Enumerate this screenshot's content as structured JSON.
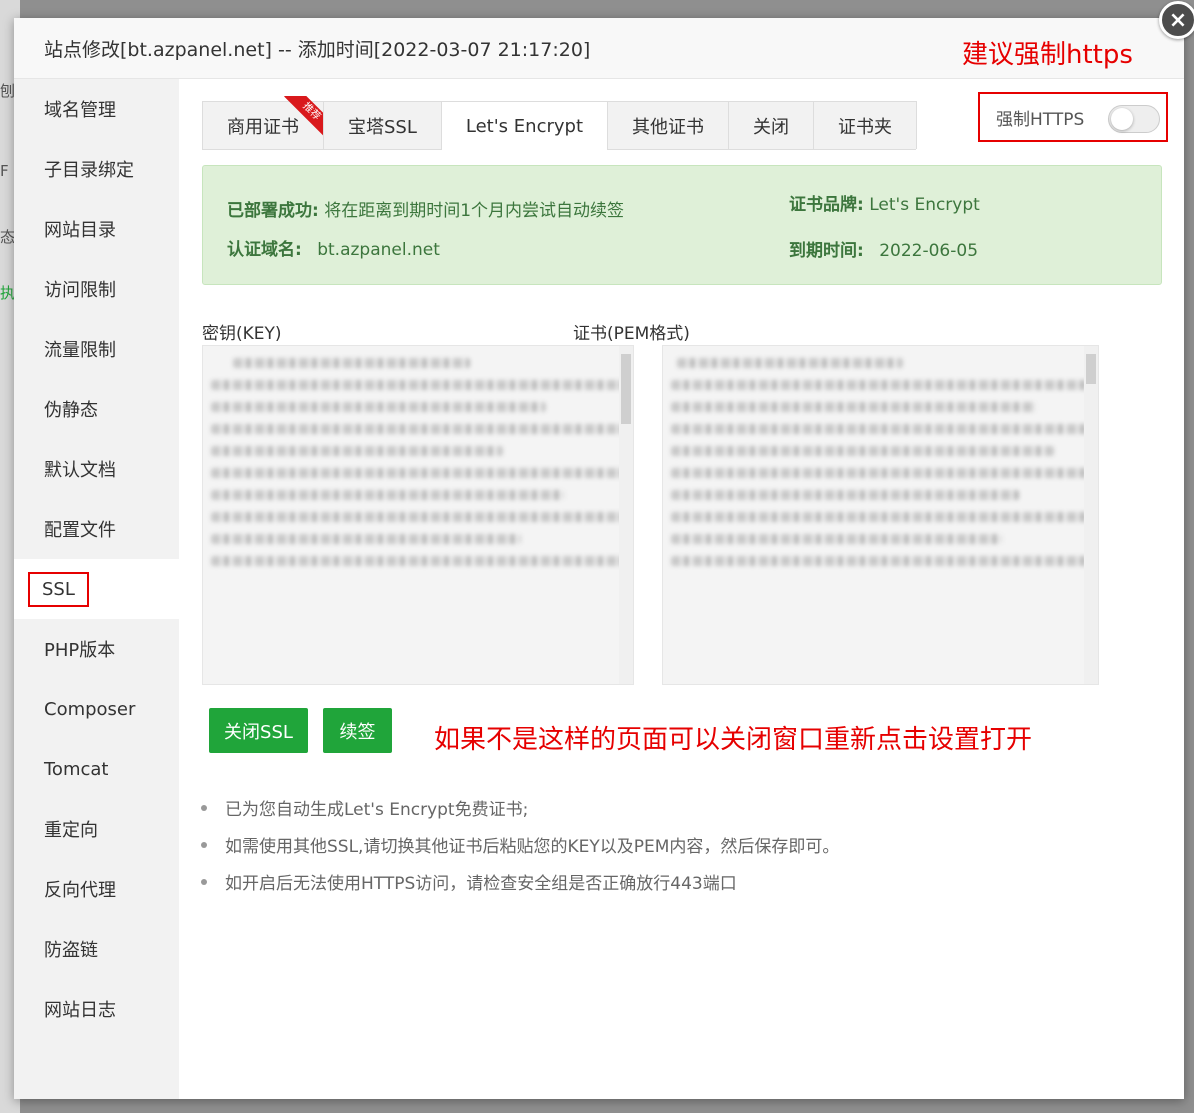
{
  "background": {
    "fragments": [
      "刨",
      "F",
      "态",
      "执"
    ]
  },
  "modal": {
    "title": "站点修改[bt.azpanel.net] -- 添加时间[2022-03-07 21:17:20]",
    "annotation_top": "建议强制https",
    "close_icon": "×"
  },
  "sidebar": {
    "items": [
      {
        "label": "域名管理"
      },
      {
        "label": "子目录绑定"
      },
      {
        "label": "网站目录"
      },
      {
        "label": "访问限制"
      },
      {
        "label": "流量限制"
      },
      {
        "label": "伪静态"
      },
      {
        "label": "默认文档"
      },
      {
        "label": "配置文件"
      },
      {
        "label": "SSL"
      },
      {
        "label": "PHP版本"
      },
      {
        "label": "Composer"
      },
      {
        "label": "Tomcat"
      },
      {
        "label": "重定向"
      },
      {
        "label": "反向代理"
      },
      {
        "label": "防盗链"
      },
      {
        "label": "网站日志"
      }
    ],
    "active": "SSL"
  },
  "tabs": {
    "items": [
      {
        "label": "商用证书",
        "badge": "推荐"
      },
      {
        "label": "宝塔SSL"
      },
      {
        "label": "Let's Encrypt"
      },
      {
        "label": "其他证书"
      },
      {
        "label": "关闭"
      },
      {
        "label": "证书夹"
      }
    ],
    "active": "Let's Encrypt"
  },
  "force_https": {
    "label": "强制HTTPS",
    "enabled": false
  },
  "status": {
    "deployed_label": "已部署成功:",
    "deployed_text": "将在距离到期时间1个月内尝试自动续签",
    "domain_label": "认证域名:",
    "domain_value": "bt.azpanel.net",
    "brand_label": "证书品牌:",
    "brand_value": "Let's Encrypt",
    "expire_label": "到期时间:",
    "expire_value": "2022-06-05"
  },
  "key_field": {
    "label": "密钥(KEY)"
  },
  "cert_field": {
    "label": "证书(PEM格式)"
  },
  "buttons": {
    "close_ssl": "关闭SSL",
    "renew": "续签"
  },
  "annotation_mid": "如果不是这样的页面可以关闭窗口重新点击设置打开",
  "tips": [
    "已为您自动生成Let's Encrypt免费证书;",
    "如需使用其他SSL,请切换其他证书后粘贴您的KEY以及PEM内容，然后保存即可。",
    "如开启后无法使用HTTPS访问，请检查安全组是否正确放行443端口"
  ],
  "colors": {
    "accent": "#20a53a",
    "annotation": "#e60000",
    "success_bg": "#dff0d8",
    "success_text": "#3c763d"
  }
}
